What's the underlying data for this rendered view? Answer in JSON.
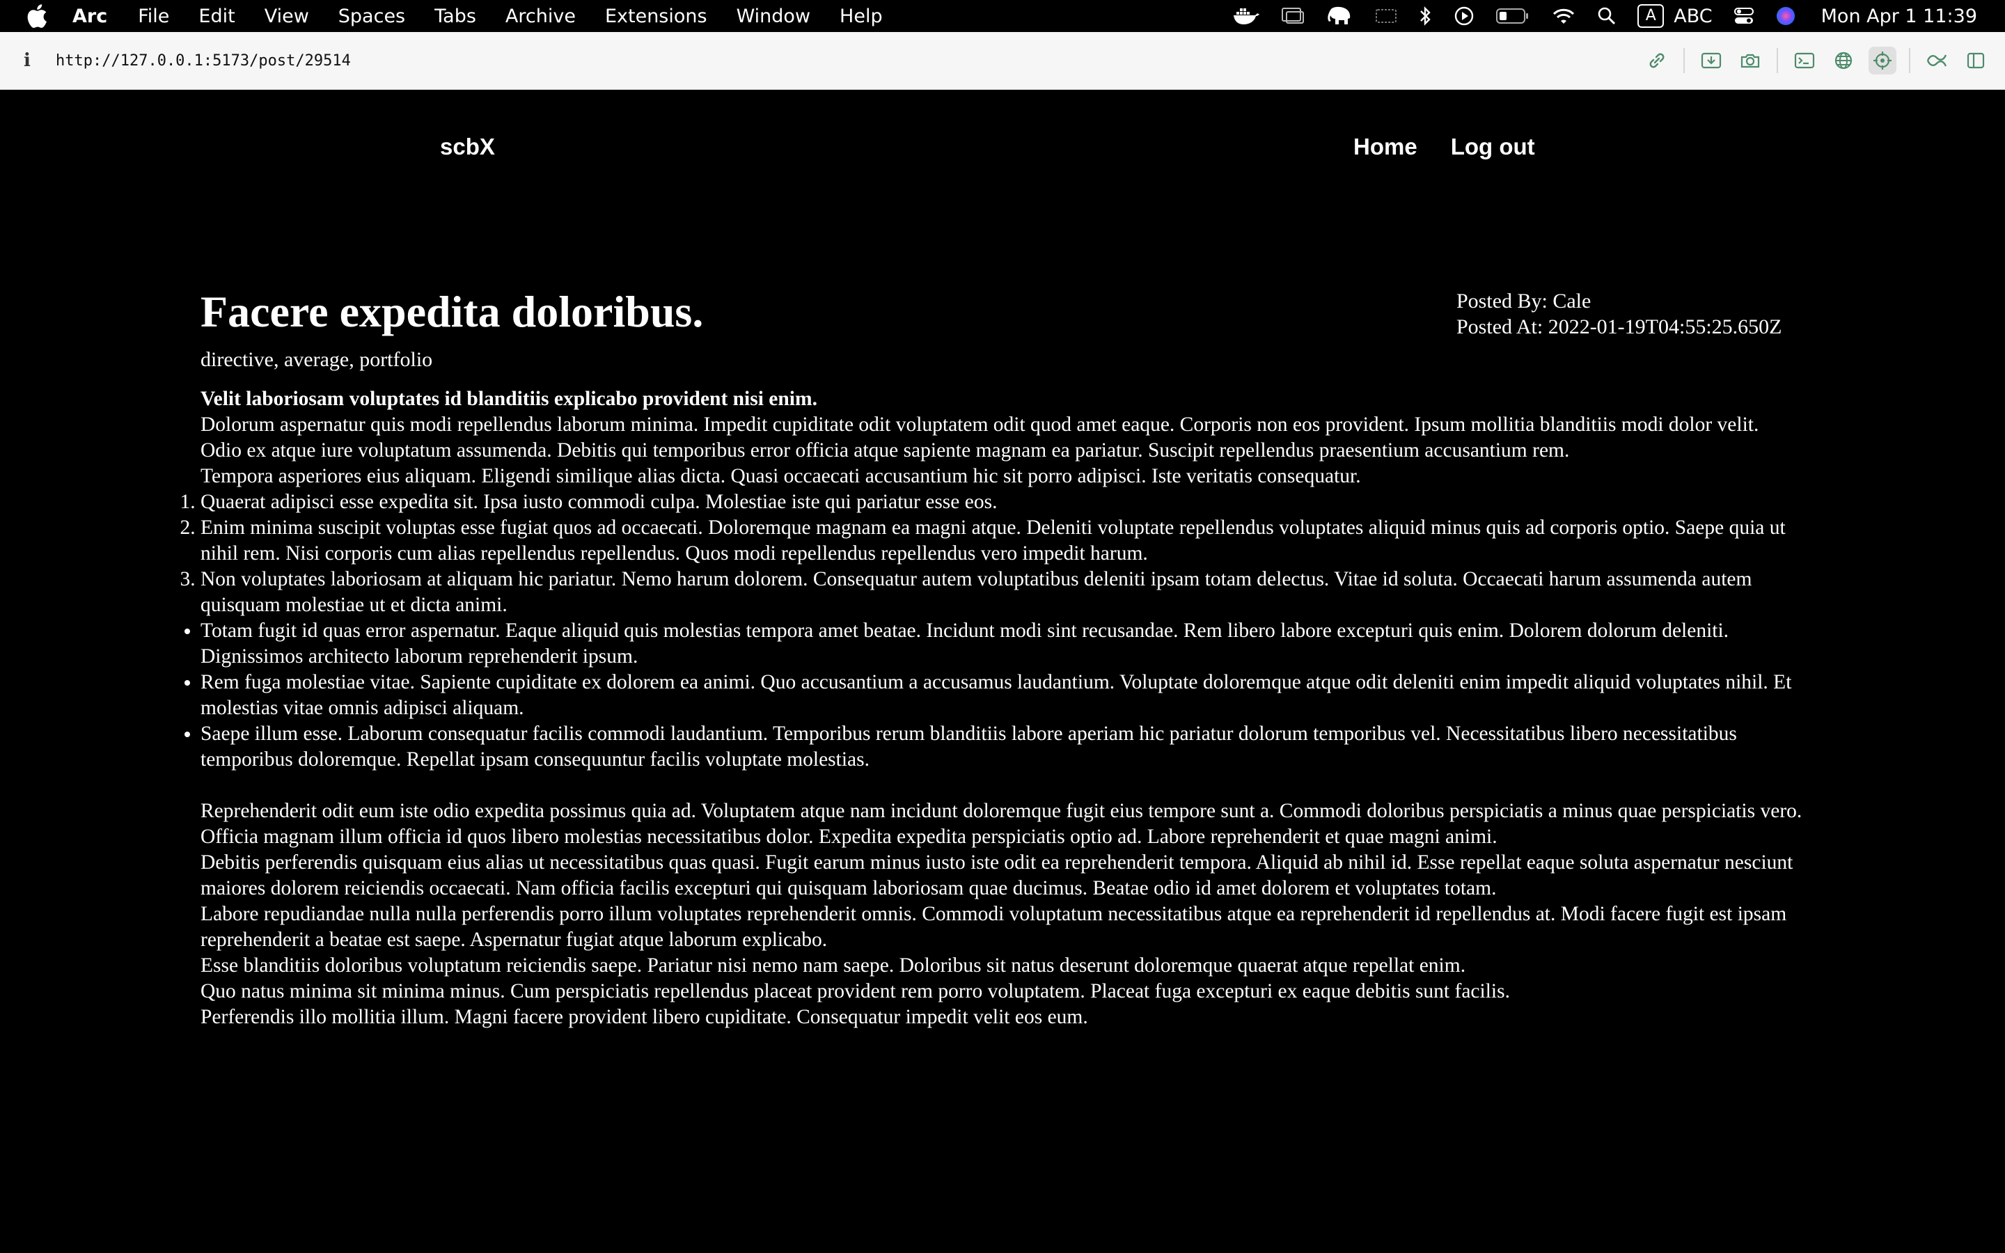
{
  "menubar": {
    "app_name": "Arc",
    "items": [
      "File",
      "Edit",
      "View",
      "Spaces",
      "Tabs",
      "Archive",
      "Extensions",
      "Window",
      "Help"
    ],
    "input_badge": "A",
    "input_label": "ABC",
    "clock": "Mon Apr 1  11:39",
    "status_icons": [
      "docker-icon",
      "display-icon",
      "elephant-icon",
      "screen-icon",
      "bluetooth-icon",
      "play-icon",
      "battery-icon",
      "wifi-icon",
      "search-icon",
      "input-source-icon",
      "control-center-icon",
      "siri-icon"
    ]
  },
  "browser": {
    "url": "http://127.0.0.1:5173/post/29514",
    "info_icon": "i",
    "tools": [
      "link-icon",
      "download-icon",
      "camera-icon",
      "terminal-icon",
      "globe-icon",
      "target-icon",
      "extensions-icon",
      "sidebar-icon"
    ]
  },
  "site": {
    "brand": "scbX",
    "nav": {
      "home": "Home",
      "logout": "Log out"
    }
  },
  "post": {
    "title": "Facere expedita doloribus.",
    "posted_by": "Posted By: Cale",
    "posted_at": "Posted At: 2022-01-19T04:55:25.650Z",
    "tags": "directive, average, portfolio",
    "lead": "Velit laboriosam voluptates id blanditiis explicabo provident nisi enim.",
    "paragraphs_top": [
      "Dolorum aspernatur quis modi repellendus laborum minima. Impedit cupiditate odit voluptatem odit quod amet eaque. Corporis non eos provident. Ipsum mollitia blanditiis modi dolor velit.",
      "Odio ex atque iure voluptatum assumenda. Debitis qui temporibus error officia atque sapiente magnam ea pariatur. Suscipit repellendus praesentium accusantium rem.",
      "Tempora asperiores eius aliquam. Eligendi similique alias dicta. Quasi occaecati accusantium hic sit porro adipisci. Iste veritatis consequatur."
    ],
    "ordered": [
      "Quaerat adipisci esse expedita sit. Ipsa iusto commodi culpa. Molestiae iste qui pariatur esse eos.",
      "Enim minima suscipit voluptas esse fugiat quos ad occaecati. Doloremque magnam ea magni atque. Deleniti voluptate repellendus voluptates aliquid minus quis ad corporis optio. Saepe quia ut nihil rem. Nisi corporis cum alias repellendus repellendus. Quos modi repellendus repellendus vero impedit harum.",
      "Non voluptates laboriosam at aliquam hic pariatur. Nemo harum dolorem. Consequatur autem voluptatibus deleniti ipsam totam delectus. Vitae id soluta. Occaecati harum assumenda autem quisquam molestiae ut et dicta animi."
    ],
    "unordered": [
      "Totam fugit id quas error aspernatur. Eaque aliquid quis molestias tempora amet beatae. Incidunt modi sint recusandae. Rem libero labore excepturi quis enim. Dolorem dolorum deleniti. Dignissimos architecto laborum reprehenderit ipsum.",
      "Rem fuga molestiae vitae. Sapiente cupiditate ex dolorem ea animi. Quo accusantium a accusamus laudantium. Voluptate doloremque atque odit deleniti enim impedit aliquid voluptates nihil. Et molestias vitae omnis adipisci aliquam.",
      "Saepe illum esse. Laborum consequatur facilis commodi laudantium. Temporibus rerum blanditiis labore aperiam hic pariatur dolorum temporibus vel. Necessitatibus libero necessitatibus temporibus doloremque. Repellat ipsam consequuntur facilis voluptate molestias."
    ],
    "paragraphs_bottom": [
      "Reprehenderit odit eum iste odio expedita possimus quia ad. Voluptatem atque nam incidunt doloremque fugit eius tempore sunt a. Commodi doloribus perspiciatis a minus quae perspiciatis vero. Officia magnam illum officia id quos libero molestias necessitatibus dolor. Expedita expedita perspiciatis optio ad. Labore reprehenderit et quae magni animi.",
      "Debitis perferendis quisquam eius alias ut necessitatibus quas quasi. Fugit earum minus iusto iste odit ea reprehenderit tempora. Aliquid ab nihil id. Esse repellat eaque soluta aspernatur nesciunt maiores dolorem reiciendis occaecati. Nam officia facilis excepturi qui quisquam laboriosam quae ducimus. Beatae odio id amet dolorem et voluptates totam.",
      "Labore repudiandae nulla nulla perferendis porro illum voluptates reprehenderit omnis. Commodi voluptatum necessitatibus atque ea reprehenderit id repellendus at. Modi facere fugit est ipsam reprehenderit a beatae est saepe. Aspernatur fugiat atque laborum explicabo.",
      "Esse blanditiis doloribus voluptatum reiciendis saepe. Pariatur nisi nemo nam saepe. Doloribus sit natus deserunt doloremque quaerat atque repellat enim.",
      "Quo natus minima sit minima minus. Cum perspiciatis repellendus placeat provident rem porro voluptatem. Placeat fuga excepturi ex eaque debitis sunt facilis.",
      "Perferendis illo mollitia illum. Magni facere provident libero cupiditate. Consequatur impedit velit eos eum."
    ]
  }
}
